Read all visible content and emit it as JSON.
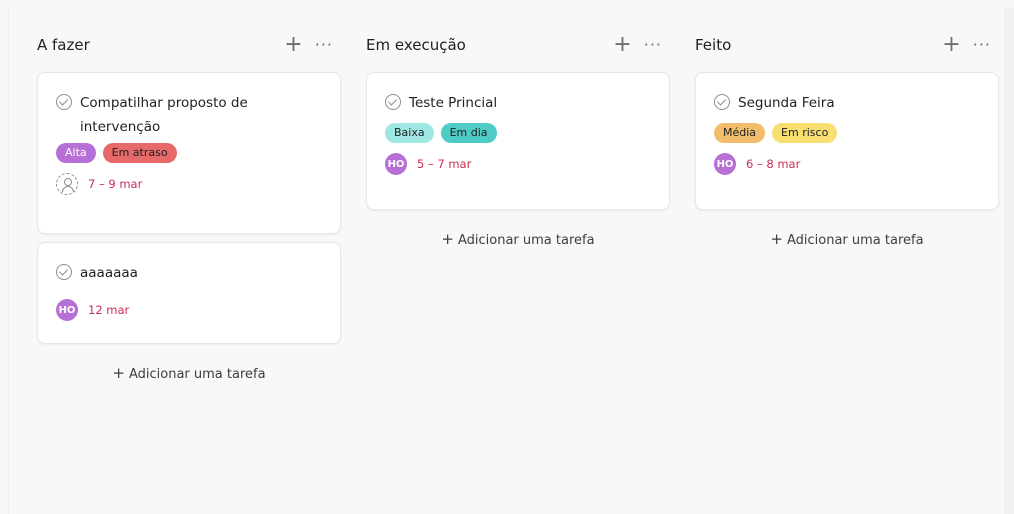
{
  "columns": [
    {
      "title": "A fazer",
      "cards": [
        {
          "title": "Compatilhar proposto de intervenção",
          "tags": [
            {
              "label": "Alta",
              "bg": "#b66fd4",
              "color": "#ffffff"
            },
            {
              "label": "Em atraso",
              "bg": "#e8696a",
              "color": "#1e1f21"
            }
          ],
          "assignee": null,
          "date": "7 – 9 mar"
        },
        {
          "title": "aaaaaaa",
          "tags": [],
          "assignee": "HO",
          "date": "12 mar"
        }
      ],
      "add_label": "Adicionar uma tarefa"
    },
    {
      "title": "Em execução",
      "cards": [
        {
          "title": "Teste Princial",
          "tags": [
            {
              "label": "Baixa",
              "bg": "#9ee7e3",
              "color": "#1e1f21"
            },
            {
              "label": "Em dia",
              "bg": "#4ecbc4",
              "color": "#1e1f21"
            }
          ],
          "assignee": "HO",
          "date": "5 – 7 mar"
        }
      ],
      "add_label": "Adicionar uma tarefa"
    },
    {
      "title": "Feito",
      "cards": [
        {
          "title": "Segunda Feira",
          "tags": [
            {
              "label": "Média",
              "bg": "#f1bd6c",
              "color": "#1e1f21"
            },
            {
              "label": "Em risco",
              "bg": "#f8df72",
              "color": "#1e1f21"
            }
          ],
          "assignee": "HO",
          "date": "6 – 8 mar"
        }
      ],
      "add_label": "Adicionar uma tarefa"
    }
  ],
  "icons": {
    "add": "+",
    "more": "···"
  },
  "colors": {
    "date": "#c92f54",
    "avatar": "#b66fd4"
  }
}
